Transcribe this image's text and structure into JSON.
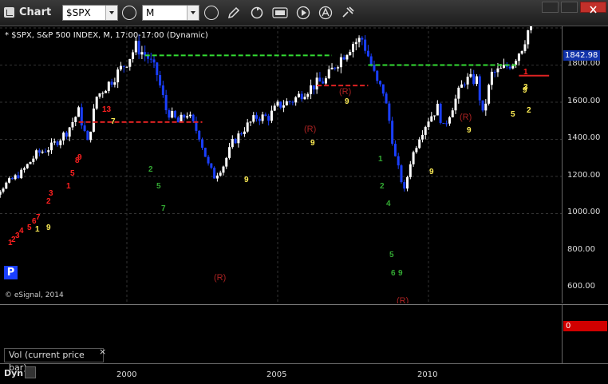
{
  "app": {
    "title": "Chart"
  },
  "toolbar": {
    "symbol_value": "$SPX",
    "interval_value": "M",
    "icons": [
      "settings-gear-icon",
      "clock-icon",
      "pencil-icon",
      "refresh-icon",
      "get-icon",
      "play-icon",
      "alert-icon",
      "link-icon"
    ]
  },
  "chart": {
    "legend_text": "* $SPX, S&P 500 INDEX, M, 17:00-17:00 (Dynamic)",
    "copyright": "© eSignal, 2014",
    "last_price": "1842.98",
    "y_ticks": [
      "1800.00",
      "1600.00",
      "1400.00",
      "1200.00",
      "1000.00",
      "800.00",
      "600.00"
    ],
    "x_ticks": [
      "2000",
      "2005",
      "2010"
    ],
    "colors": {
      "up_candle": "#ffffff",
      "down_candle": "#1a3fff",
      "support": "#33dd33",
      "resistance": "#dd2222",
      "count_yellow": "#ffee55",
      "count_red": "#ff2020",
      "count_green": "#33aa33",
      "marker_r": "#aa2222"
    },
    "markers": {
      "r_label": "(R)"
    },
    "counts": {
      "red": [
        "1",
        "2",
        "3",
        "4",
        "5",
        "6",
        "7",
        "8",
        "9",
        "13",
        "1",
        "2",
        "3",
        "5",
        "1"
      ],
      "yellow": [
        "9",
        "7",
        "9",
        "9",
        "9",
        "9",
        "9",
        "9",
        "1",
        "2",
        "3",
        "5"
      ],
      "green": [
        "2",
        "7",
        "5",
        "1",
        "2",
        "4",
        "5",
        "6",
        "9"
      ]
    }
  },
  "chart_data": {
    "type": "candlestick",
    "symbol": "$SPX",
    "interval": "M",
    "ylim": [
      560,
      1900
    ],
    "x_ticks": [
      "2000",
      "2005",
      "2010"
    ],
    "last_price": 1842.98,
    "levels": [
      {
        "color": "green",
        "value": 1452,
        "from": 2000.6,
        "to": 2006.8
      },
      {
        "color": "red",
        "value": 1093,
        "from": 1998.4,
        "to": 2002.5
      },
      {
        "color": "red",
        "value": 1290,
        "from": 2006.3,
        "to": 2008.0
      },
      {
        "color": "green",
        "value": 1400,
        "from": 2008.0,
        "to": 2012.9
      },
      {
        "color": "red",
        "value": 1343,
        "from": 2013.0,
        "to": 2014.0
      }
    ],
    "series": [
      {
        "values": [
          [
            1995.0,
            620
          ],
          [
            1995.5,
            690
          ],
          [
            1996.0,
            760
          ],
          [
            1996.5,
            820
          ],
          [
            1997.0,
            920
          ],
          [
            1997.5,
            960
          ],
          [
            1998.0,
            1040
          ],
          [
            1998.4,
            1150
          ],
          [
            1998.7,
            980
          ],
          [
            1999.0,
            1230
          ],
          [
            1999.5,
            1320
          ],
          [
            2000.0,
            1420
          ],
          [
            2000.3,
            1500
          ],
          [
            2000.7,
            1440
          ],
          [
            2001.0,
            1350
          ],
          [
            2001.3,
            1160
          ],
          [
            2001.7,
            1090
          ],
          [
            2002.0,
            1140
          ],
          [
            2002.4,
            1020
          ],
          [
            2002.7,
            860
          ],
          [
            2002.9,
            800
          ],
          [
            2003.2,
            860
          ],
          [
            2003.5,
            980
          ],
          [
            2003.9,
            1060
          ],
          [
            2004.3,
            1120
          ],
          [
            2004.7,
            1120
          ],
          [
            2005.0,
            1180
          ],
          [
            2005.5,
            1210
          ],
          [
            2005.9,
            1260
          ],
          [
            2006.3,
            1300
          ],
          [
            2006.6,
            1320
          ],
          [
            2006.9,
            1400
          ],
          [
            2007.2,
            1460
          ],
          [
            2007.5,
            1520
          ],
          [
            2007.8,
            1540
          ],
          [
            2008.0,
            1450
          ],
          [
            2008.3,
            1300
          ],
          [
            2008.5,
            1260
          ],
          [
            2008.7,
            1100
          ],
          [
            2008.9,
            900
          ],
          [
            2009.2,
            720
          ],
          [
            2009.4,
            880
          ],
          [
            2009.7,
            1020
          ],
          [
            2010.0,
            1110
          ],
          [
            2010.3,
            1170
          ],
          [
            2010.5,
            1060
          ],
          [
            2010.8,
            1180
          ],
          [
            2011.2,
            1320
          ],
          [
            2011.6,
            1320
          ],
          [
            2011.8,
            1130
          ],
          [
            2012.1,
            1350
          ],
          [
            2012.5,
            1380
          ],
          [
            2012.8,
            1420
          ],
          [
            2013.1,
            1500
          ],
          [
            2013.4,
            1630
          ],
          [
            2013.7,
            1690
          ],
          [
            2014.0,
            1842.98
          ]
        ]
      }
    ]
  },
  "volume": {
    "label": "Vol (current price bar)",
    "close_symbol": "×",
    "value": "0"
  },
  "footer": {
    "dyn_label": "Dyn"
  }
}
